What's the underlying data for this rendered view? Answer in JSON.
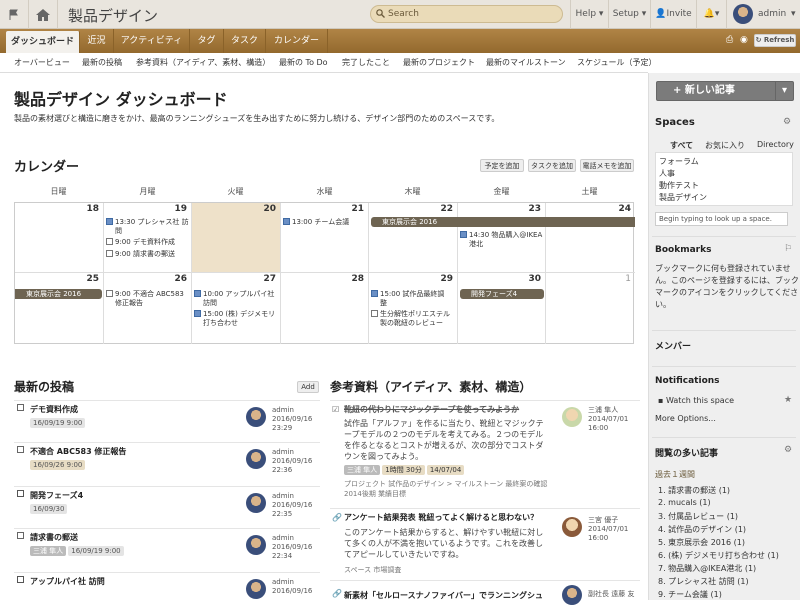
{
  "app": {
    "title": "製品デザイン",
    "search_placeholder": "Search",
    "help": "Help",
    "setup": "Setup",
    "invite": "Invite",
    "user": "admin"
  },
  "tabs": [
    "ダッシュボード",
    "近況",
    "アクティビティ",
    "タグ",
    "タスク",
    "カレンダー"
  ],
  "refresh": "Refresh",
  "subnav": [
    "オーバービュー",
    "最新の投稿",
    "参考資料（アイディア、素材、構造）",
    "最新の To Do",
    "完了したこと",
    "最新のプロジェクト",
    "最新のマイルストーン",
    "スケジュール（予定）"
  ],
  "page": {
    "title": "製品デザイン ダッシュボード",
    "description": "製品の素材選びと構造に磨きをかけ、最高のランニングシューズを生み出すために努力し続ける、デザイン部門のためのスペースです。"
  },
  "calendar": {
    "title": "カレンダー",
    "buttons": [
      "予定を追加",
      "タスクを追加",
      "電話メモを追加"
    ],
    "weekdays": [
      "日曜",
      "月曜",
      "火曜",
      "水曜",
      "木曜",
      "金曜",
      "土曜"
    ],
    "week1": [
      "18",
      "19",
      "20",
      "21",
      "22",
      "23",
      "24"
    ],
    "week2": [
      "25",
      "26",
      "27",
      "28",
      "29",
      "30",
      "1"
    ],
    "events": {
      "mon19_1": "13:30 プレシャス社 訪",
      "mon19_1b": "問",
      "mon19_2": "9:00 デモ資料作成",
      "mon19_3": "9:00 請求書の郵送",
      "wed21_1": "13:00 チーム会議",
      "thu22_bar": "東京展示会 2016",
      "fri23_1": "14:30 物品購入@IKEA",
      "fri23_1b": "港北",
      "sun25_bar": "東京展示会 2016",
      "mon26_1": "9:00 不適合 ABC583",
      "mon26_1b": "修正報告",
      "tue27_1": "10:00 アップルパイ社",
      "tue27_1b": "訪問",
      "tue27_2": "15:00 (株) デジメモリ",
      "tue27_2b": "打ち合わせ",
      "thu29_1": "15:00 試作品最終調",
      "thu29_1b": "整",
      "thu29_2": "生分解性ポリエステル",
      "thu29_2b": "製の靴紐のレビュー",
      "fri30_bar": "開発フェーズ4"
    }
  },
  "posts": {
    "title": "最新の投稿",
    "add": "Add",
    "items": [
      {
        "title": "デモ資料作成",
        "tag1": "16/09/19 9:00",
        "tag2": "",
        "user": "admin",
        "date": "2016/09/16",
        "time": "23:29"
      },
      {
        "title": "不適合 ABC583 修正報告",
        "tag1": "16/09/26 9:00",
        "tag2": "",
        "user": "admin",
        "date": "2016/09/16",
        "time": "22:36"
      },
      {
        "title": "開発フェーズ4",
        "tag1": "16/09/30",
        "tag2": "",
        "user": "admin",
        "date": "2016/09/16",
        "time": "22:35"
      },
      {
        "title": "請求書の郵送",
        "tag1": "三浦 隼人",
        "tag2": "16/09/19 9:00",
        "user": "admin",
        "date": "2016/09/16",
        "time": "22:34"
      },
      {
        "title": "アップルパイ社 訪問",
        "tag1": "",
        "tag2": "",
        "user": "admin",
        "date": "2016/09/16",
        "time": ""
      }
    ]
  },
  "refs": {
    "title": "参考資料（アイディア、素材、構造）",
    "items": [
      {
        "title": "靴紐の代わりにマジックテープを使ってみようか",
        "body": "試作品「アルファ」を作るに当たり、靴紐とマジックテープモデルの２つのモデルを考えてみる。２つのモデルを作るとなるとコストが増えるが、次の部分でコストダウンを図ってみよう。",
        "chip1": "三浦 隼人",
        "chip2": "1時間 30分",
        "chip3": "14/07/04",
        "path": "プロジェクト 試作品のデザイン > マイルストーン 最終案の確認",
        "path2": "2014後期 業績目標",
        "user": "三浦 隼人",
        "date": "2014/07/01",
        "time": "16:00"
      },
      {
        "title": "アンケート結果発表 靴紐ってよく解けると思わない？",
        "body": "このアンケート結果からすると、解けやすい靴紐に対して多くの人が不満を抱いているようです。これを改善してアピールしていきたいですね。",
        "space": "スペース 市場調査",
        "user": "三宮 優子",
        "date": "2014/07/01",
        "time": "16:00"
      },
      {
        "title": "新素材「セルロースナノファイバー」でランニングシュ",
        "user": "副社長 遠藤 友"
      }
    ]
  },
  "sidebar": {
    "new_post": "新しい記事",
    "spaces_title": "Spaces",
    "space_tabs": [
      "すべて",
      "お気に入り",
      "Directory"
    ],
    "spaces": [
      "フォーラム",
      "人事",
      "動作テスト",
      "製品デザイン"
    ],
    "space_input": "Begin typing to look up a space.",
    "bookmarks_title": "Bookmarks",
    "bookmarks_text": [
      "ブックマークに何も登録されていませ",
      "ん。このページを登録するには、ブック",
      "マークのアイコンをクリックしてくださ",
      "い。"
    ],
    "members_title": "メンバー",
    "notifications_title": "Notifications",
    "watch": "Watch this space",
    "more": "More Options...",
    "popular_title": "閲覧の多い記事",
    "popular_period": "過去１週間",
    "popular": [
      "1. 請求書の郵送 (1)",
      "2. mucals (1)",
      "3. 付属品レビュー (1)",
      "4. 試作品のデザイン (1)",
      "5. 東京展示会 2016 (1)",
      "6. (株) デジメモリ打ち合わせ (1)",
      "7. 物品購入@IKEA港北 (1)",
      "8. プレシャス社 訪問 (1)",
      "9. チーム会議 (1)"
    ]
  },
  "colors": {
    "tabbar": "#a2783a",
    "today": "#eee1c9",
    "event_bar": "#6e6452"
  }
}
